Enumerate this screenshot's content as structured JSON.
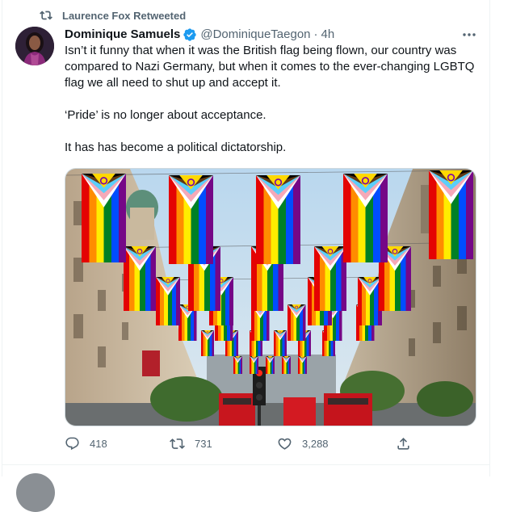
{
  "retweet": {
    "label": "Laurence Fox Retweeted",
    "icon": "retweet-icon"
  },
  "author": {
    "display_name": "Dominique Samuels",
    "handle": "@DominiqueTaegon",
    "separator": "·",
    "time": "4h",
    "verified": true
  },
  "tweet": {
    "paragraphs": [
      "Isn’t it funny that when it was the British flag being flown, our country was compared to Nazi Germany, but when it comes to the ever-changing LGBTQ flag we all need to shut up and accept it.",
      "‘Pride’ is no longer about acceptance.",
      "It has has become a political dictatorship."
    ]
  },
  "media": {
    "alt": "Street lined with Progress Pride flags"
  },
  "actions": {
    "replies": "418",
    "retweets": "731",
    "likes": "3,288"
  },
  "colors": {
    "accent": "#1d9bf0",
    "retweet_green": "#00ba7c",
    "text": "#0f1419",
    "secondary": "#536471"
  }
}
